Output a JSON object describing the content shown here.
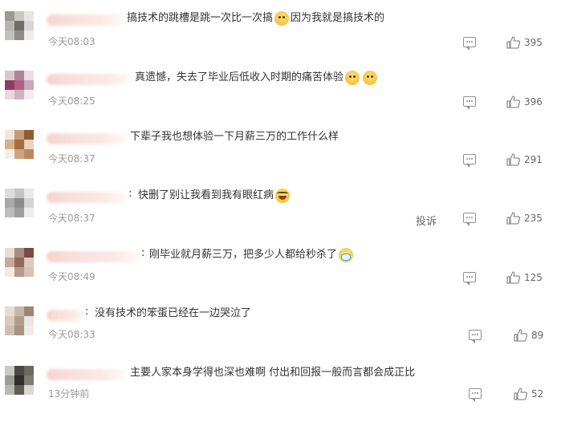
{
  "report_label": "投诉",
  "comments": [
    {
      "text": "搞技术的跳槽是跳一次比一次搞",
      "text2": "因为我就是搞技术的",
      "time": "今天08:03",
      "likes": "395",
      "avatar": [
        "#9a9a94",
        "#c9c7c2",
        "#e8e6e2",
        "#b5b4af",
        "#6e6d68",
        "#d8d6d2",
        "#c2c0bb",
        "#8d8c87",
        "#efedea"
      ]
    },
    {
      "text": "真遗憾，失去了毕业后低收入时期的痛苦体验",
      "time": "今天08:25",
      "likes": "396",
      "avatar": [
        "#d9c7cf",
        "#b08399",
        "#eadde3",
        "#8e3e64",
        "#b25e84",
        "#c9a8b8",
        "#e6d6de",
        "#cfb3c1",
        "#f3ebef"
      ]
    },
    {
      "text": "下辈子我也想体验一下月薪三万的工作什么样",
      "time": "今天08:37",
      "likes": "291",
      "avatar": [
        "#f0e6dc",
        "#c59c74",
        "#8d5c36",
        "#d8b08a",
        "#a2703f",
        "#e9d3bb",
        "#f6efe8",
        "#cfa47e",
        "#b88a60"
      ]
    },
    {
      "text": "快删了别让我看到我有眼红病",
      "time": "今天08:37",
      "likes": "235",
      "avatar": [
        "#dcdcdc",
        "#c4c4c4",
        "#e9e9e9",
        "#a9a9a9",
        "#8c8c8c",
        "#d3d3d3",
        "#bdbdbd",
        "#9d9d9d",
        "#ececec"
      ]
    },
    {
      "text": "刚毕业就月薪三万，把多少人都给秒杀了",
      "time": "今天08:49",
      "likes": "125",
      "avatar": [
        "#e8ddd6",
        "#a98d80",
        "#704e43",
        "#c7a99a",
        "#8f6a5a",
        "#ddc8bd",
        "#f2eae5",
        "#b9998a",
        "#d6c2b7"
      ]
    },
    {
      "text": "没有技术的笨蛋已经在一边哭泣了",
      "time": "今天08:33",
      "likes": "89",
      "avatar": [
        "#e3ddd6",
        "#c6b8aa",
        "#9c8573",
        "#d7cbc0",
        "#b39d8a",
        "#ece6e0",
        "#cdbfb2",
        "#a89280",
        "#f1ece7"
      ]
    },
    {
      "text": "主要人家本身学得也深也难啊 付出和回报一般而言都会成正比",
      "time": "13分钟前",
      "likes": "52",
      "avatar": [
        "#c9c9c3",
        "#4a4a44",
        "#6b6a62",
        "#9e9d95",
        "#2e2e2a",
        "#7d7c73",
        "#b8b7b0",
        "#5d5c55",
        "#d8d7d1"
      ]
    }
  ]
}
